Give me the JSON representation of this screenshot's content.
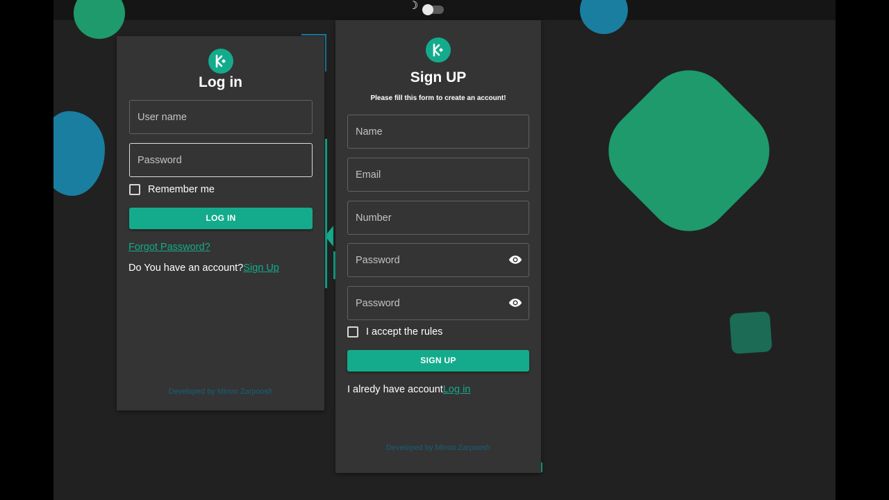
{
  "theme": {
    "accent": "#14ab8c",
    "background": "#212121",
    "card": "#343434",
    "blob_green": "#1e9a6c",
    "blob_blue": "#1a7ea0",
    "blob_dark_green": "#1b6b55",
    "footer_text": "#17607a"
  },
  "header": {
    "theme_toggle_icon": "moon-icon"
  },
  "login": {
    "logo_icon": "kucoin-logo-icon",
    "title": "Log in",
    "username_placeholder": "User name",
    "password_placeholder": "Password",
    "remember_label": "Remember me",
    "submit_label": "LOG IN",
    "forgot_label": "Forgot Password?",
    "account_prompt": "Do You have an account?",
    "signup_link": "Sign Up",
    "footer": "Developed by Minoo Zarpoosh"
  },
  "signup": {
    "logo_icon": "kucoin-logo-icon",
    "title": "Sign UP",
    "subtitle": "Please fill this form to create an account!",
    "name_placeholder": "Name",
    "email_placeholder": "Email",
    "number_placeholder": "Number",
    "password_placeholder": "Password",
    "confirm_password_placeholder": "Password",
    "rules_label": "I accept the rules",
    "submit_label": "SIGN UP",
    "have_account_prompt": "I alredy have account",
    "login_link": "Log in",
    "footer": "Developed by Minoo Zarpoosh"
  }
}
